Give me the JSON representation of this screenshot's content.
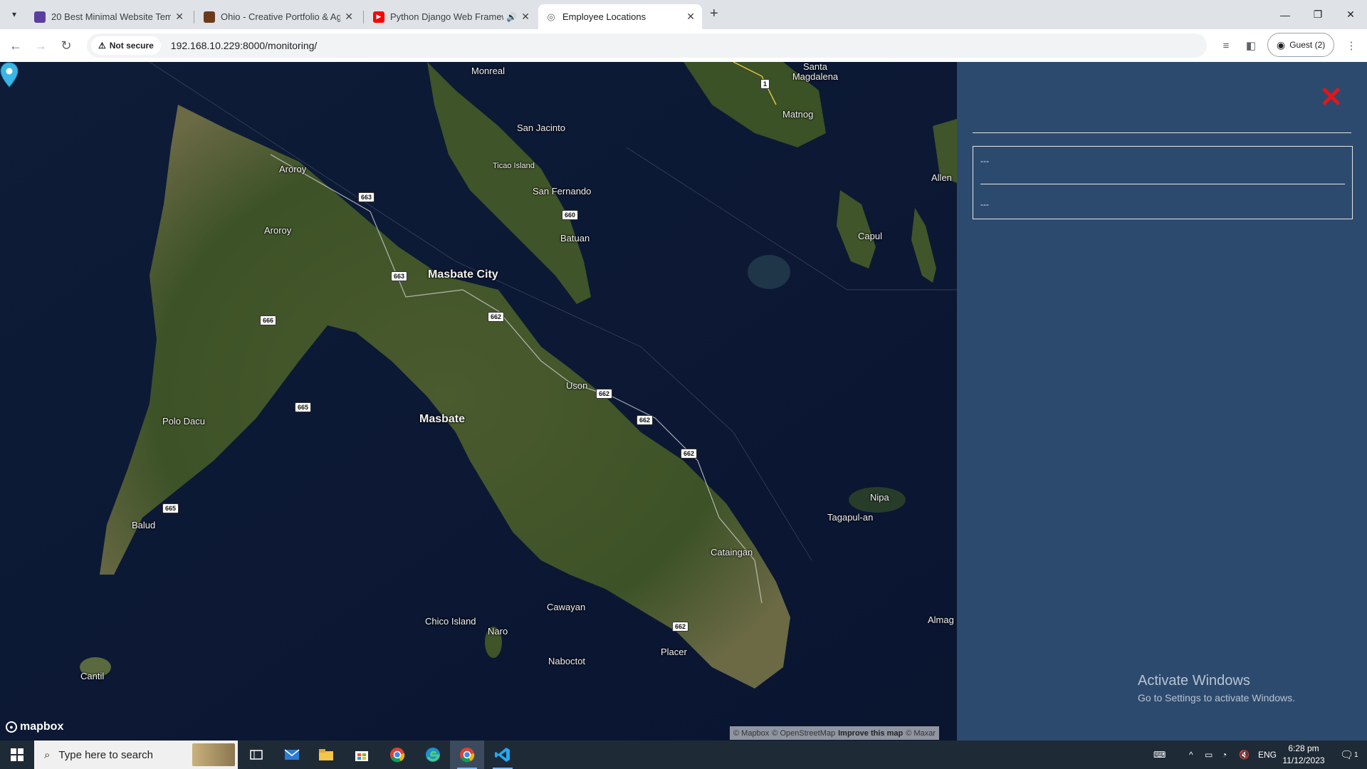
{
  "browser": {
    "tabs": [
      {
        "title": "20 Best Minimal Website Templ",
        "favicon_color": "#5b3fa0"
      },
      {
        "title": "Ohio - Creative Portfolio & Age",
        "favicon_color": "#6b3b1b"
      },
      {
        "title": "Python Django Web Framew",
        "favicon_color": "#ff0000",
        "audio": true
      },
      {
        "title": "Employee Locations",
        "favicon_color": "#5f6368",
        "active": true
      }
    ],
    "security_label": "Not secure",
    "url": "192.168.10.229:8000/monitoring/",
    "profile_label": "Guest (2)"
  },
  "map": {
    "places": [
      {
        "name": "Monreal",
        "size": "normal"
      },
      {
        "name": "Santa Magdalena",
        "size": "normal"
      },
      {
        "name": "Matnog",
        "size": "normal"
      },
      {
        "name": "San Jacinto",
        "size": "normal"
      },
      {
        "name": "Ticao Island",
        "size": "small"
      },
      {
        "name": "San Fernando",
        "size": "normal"
      },
      {
        "name": "Aroroy",
        "size": "normal"
      },
      {
        "name": "Aroroy",
        "size": "normal"
      },
      {
        "name": "Batuan",
        "size": "normal"
      },
      {
        "name": "Masbate City",
        "size": "big"
      },
      {
        "name": "Allen",
        "size": "normal"
      },
      {
        "name": "Capul",
        "size": "normal"
      },
      {
        "name": "Uson",
        "size": "normal"
      },
      {
        "name": "Masbate",
        "size": "big"
      },
      {
        "name": "Polo Dacu",
        "size": "normal"
      },
      {
        "name": "Nipa",
        "size": "normal"
      },
      {
        "name": "Tagapul-an",
        "size": "normal"
      },
      {
        "name": "Balud",
        "size": "normal"
      },
      {
        "name": "Cataingan",
        "size": "normal"
      },
      {
        "name": "Cawayan",
        "size": "normal"
      },
      {
        "name": "Chico Island",
        "size": "normal"
      },
      {
        "name": "Naro",
        "size": "normal"
      },
      {
        "name": "Almag",
        "size": "normal"
      },
      {
        "name": "Placer",
        "size": "normal"
      },
      {
        "name": "Naboctot",
        "size": "normal"
      },
      {
        "name": "Cantil",
        "size": "normal"
      }
    ],
    "road_shields": [
      "1",
      "663",
      "660",
      "663",
      "662",
      "666",
      "662",
      "665",
      "662",
      "662",
      "665",
      "662"
    ],
    "logo_text": "mapbox",
    "attribution": {
      "mapbox": "© Mapbox",
      "osm": "© OpenStreetMap",
      "improve": "Improve this map",
      "maxar": "© Maxar"
    },
    "marker_color": "#3cb4e6"
  },
  "panel": {
    "close_symbol": "✕",
    "line1": "---",
    "line2": "---",
    "watermark_title": "Activate Windows",
    "watermark_subtitle": "Go to Settings to activate Windows."
  },
  "taskbar": {
    "search_placeholder": "Type here to search",
    "language": "ENG",
    "time": "6:28 pm",
    "date": "11/12/2023",
    "notification_count": "1"
  }
}
